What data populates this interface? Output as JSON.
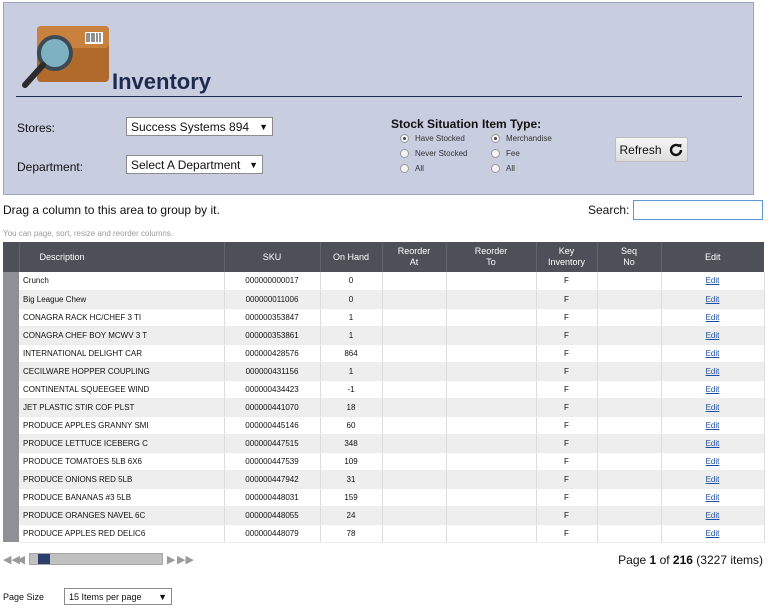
{
  "header": {
    "title": "Inventory"
  },
  "filters": {
    "stores_label": "Stores:",
    "stores_value": "Success Systems 894",
    "department_label": "Department:",
    "department_value": "Select A Department",
    "stock_title": "Stock Situation",
    "stock_options": [
      "Have Stocked",
      "Never Stocked",
      "All"
    ],
    "stock_selected": 0,
    "item_type_title": "Item Type:",
    "item_type_options": [
      "Merchandise",
      "Fee",
      "All"
    ],
    "item_type_selected": 0,
    "refresh_label": "Refresh"
  },
  "toolbar": {
    "drag_hint": "Drag a column to this area to group by it.",
    "search_label": "Search:",
    "search_value": "",
    "grid_hint": "You can page, sort, resize and reorder columns."
  },
  "grid": {
    "columns": [
      "Description",
      "SKU",
      "On Hand",
      "Reorder At",
      "Reorder To",
      "Key Inventory",
      "Seq No",
      "Edit"
    ],
    "rows": [
      {
        "description": "Crunch",
        "sku": "000000000017",
        "on_hand": "0",
        "reorder_at": "",
        "reorder_to": "",
        "key": "F",
        "seq": "",
        "edit": "Edit"
      },
      {
        "description": "Big League Chew",
        "sku": "000000011006",
        "on_hand": "0",
        "reorder_at": "",
        "reorder_to": "",
        "key": "F",
        "seq": "",
        "edit": "Edit"
      },
      {
        "description": "CONAGRA RACK HC/CHEF 3 TI",
        "sku": "000000353847",
        "on_hand": "1",
        "reorder_at": "",
        "reorder_to": "",
        "key": "F",
        "seq": "",
        "edit": "Edit"
      },
      {
        "description": "CONAGRA CHEF BOY MCWV 3 T",
        "sku": "000000353861",
        "on_hand": "1",
        "reorder_at": "",
        "reorder_to": "",
        "key": "F",
        "seq": "",
        "edit": "Edit"
      },
      {
        "description": "INTERNATIONAL DELIGHT CAR",
        "sku": "000000428576",
        "on_hand": "864",
        "reorder_at": "",
        "reorder_to": "",
        "key": "F",
        "seq": "",
        "edit": "Edit"
      },
      {
        "description": "CECILWARE HOPPER COUPLING",
        "sku": "000000431156",
        "on_hand": "1",
        "reorder_at": "",
        "reorder_to": "",
        "key": "F",
        "seq": "",
        "edit": "Edit"
      },
      {
        "description": "CONTINENTAL SQUEEGEE WIND",
        "sku": "000000434423",
        "on_hand": "-1",
        "reorder_at": "",
        "reorder_to": "",
        "key": "F",
        "seq": "",
        "edit": "Edit"
      },
      {
        "description": "JET PLASTIC STIR COF PLST",
        "sku": "000000441070",
        "on_hand": "18",
        "reorder_at": "",
        "reorder_to": "",
        "key": "F",
        "seq": "",
        "edit": "Edit"
      },
      {
        "description": "PRODUCE APPLES GRANNY SMI",
        "sku": "000000445146",
        "on_hand": "60",
        "reorder_at": "",
        "reorder_to": "",
        "key": "F",
        "seq": "",
        "edit": "Edit"
      },
      {
        "description": "PRODUCE LETTUCE ICEBERG C",
        "sku": "000000447515",
        "on_hand": "348",
        "reorder_at": "",
        "reorder_to": "",
        "key": "F",
        "seq": "",
        "edit": "Edit"
      },
      {
        "description": "PRODUCE TOMATOES 5LB 6X6",
        "sku": "000000447539",
        "on_hand": "109",
        "reorder_at": "",
        "reorder_to": "",
        "key": "F",
        "seq": "",
        "edit": "Edit"
      },
      {
        "description": "PRODUCE ONIONS RED 5LB",
        "sku": "000000447942",
        "on_hand": "31",
        "reorder_at": "",
        "reorder_to": "",
        "key": "F",
        "seq": "",
        "edit": "Edit"
      },
      {
        "description": "PRODUCE BANANAS #3 5LB",
        "sku": "000000448031",
        "on_hand": "159",
        "reorder_at": "",
        "reorder_to": "",
        "key": "F",
        "seq": "",
        "edit": "Edit"
      },
      {
        "description": "PRODUCE ORANGES NAVEL 6C",
        "sku": "000000448055",
        "on_hand": "24",
        "reorder_at": "",
        "reorder_to": "",
        "key": "F",
        "seq": "",
        "edit": "Edit"
      },
      {
        "description": "PRODUCE APPLES RED DELIC6",
        "sku": "000000448079",
        "on_hand": "78",
        "reorder_at": "",
        "reorder_to": "",
        "key": "F",
        "seq": "",
        "edit": "Edit"
      }
    ]
  },
  "pagination": {
    "page_word": "Page",
    "current_page": "1",
    "of_word": "of",
    "total_pages": "216",
    "items_text": "(3227 items)",
    "page_size_label": "Page Size",
    "page_size_value": "15 Items per page",
    "scroll_position": 0.06
  },
  "colors": {
    "header_panel": "#c8cde0",
    "grid_header": "#4d5056",
    "title": "#1d2a4d",
    "link": "#1a4fa3"
  }
}
